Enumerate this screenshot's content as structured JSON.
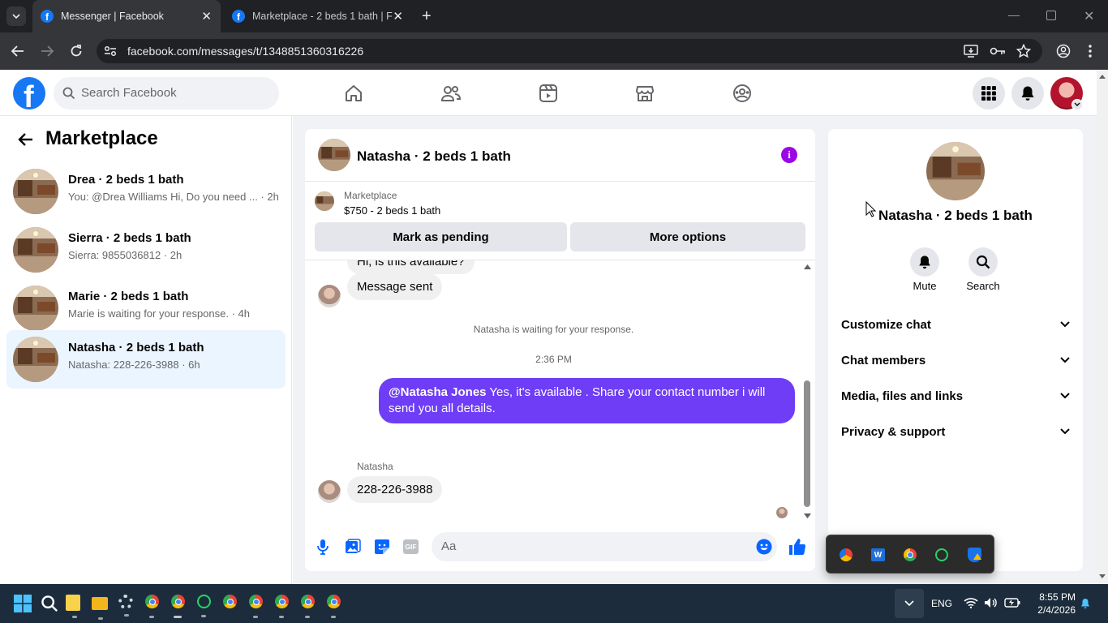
{
  "browser": {
    "tabs": [
      {
        "title": "Messenger | Facebook",
        "active": true
      },
      {
        "title": "Marketplace - 2 beds 1 bath | F",
        "active": false
      }
    ],
    "url": "facebook.com/messages/t/1348851360316226"
  },
  "fb_header": {
    "search_placeholder": "Search Facebook"
  },
  "left_panel": {
    "title": "Marketplace",
    "conversations": [
      {
        "name": "Drea · 2 beds 1 bath",
        "preview": "You: @Drea Williams Hi, Do you need ... · 2h",
        "selected": false
      },
      {
        "name": "Sierra · 2 beds 1 bath",
        "preview": "Sierra: 9855036812 · 2h",
        "selected": false
      },
      {
        "name": "Marie · 2 beds 1 bath",
        "preview": "Marie is waiting for your response. · 4h",
        "selected": false
      },
      {
        "name": "Natasha · 2 beds 1 bath",
        "preview": "Natasha: 228-226-3988 · 6h",
        "selected": true
      }
    ]
  },
  "chat": {
    "title": "Natasha · 2 beds 1 bath",
    "listing": {
      "label": "Marketplace",
      "price_title": "$750 - 2 beds 1 bath"
    },
    "buttons": {
      "pending": "Mark as pending",
      "more": "More options"
    },
    "messages": {
      "partial": "Hi, is this available?",
      "sent_notice": "Message sent",
      "waiting": "Natasha is waiting for your response.",
      "time": "2:36 PM",
      "outgoing_mention": "@Natasha Jones",
      "outgoing_text": " Yes, it's available . Share your contact number i will send you all details.",
      "sender": "Natasha",
      "incoming": "228-226-3988"
    },
    "composer_placeholder": "Aa"
  },
  "right_panel": {
    "name": "Natasha · 2 beds 1 bath",
    "actions": {
      "mute": "Mute",
      "search": "Search"
    },
    "sections": [
      "Customize chat",
      "Chat members",
      "Media, files and links",
      "Privacy & support"
    ]
  },
  "taskbar": {
    "language": "ENG",
    "time": "8:55 PM",
    "date": "2/4/2026"
  },
  "colors": {
    "fb_blue": "#1877f2",
    "messenger_purple": "#6e3df5",
    "selected_bg": "#ebf5ff"
  }
}
